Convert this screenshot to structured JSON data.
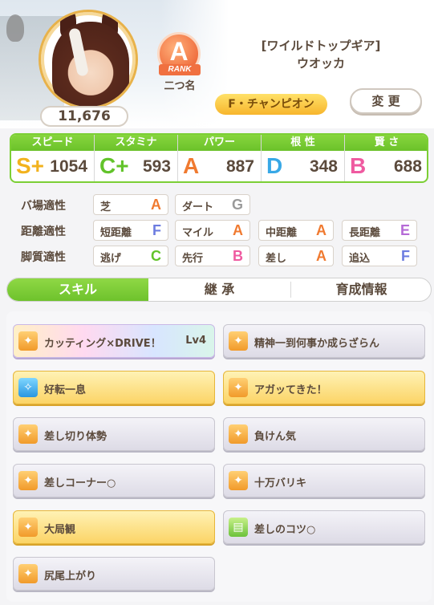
{
  "header": {
    "fans": "11,676",
    "rank": {
      "letter": "A",
      "label": "RANK"
    },
    "nickname": "二つ名",
    "title_line1": "[ワイルドトップギア]",
    "title_line2": "ウオッカ",
    "champion_title": "F・チャンピオン",
    "change_label": "変 更"
  },
  "stats": [
    {
      "label": "スピード",
      "grade": "S+",
      "value": "1054",
      "color": "#f2b21d"
    },
    {
      "label": "スタミナ",
      "grade": "C+",
      "value": "593",
      "color": "#62c32a"
    },
    {
      "label": "パワー",
      "grade": "A",
      "value": "887",
      "color": "#f07a30"
    },
    {
      "label": "根 性",
      "grade": "D",
      "value": "348",
      "color": "#38a8e6"
    },
    {
      "label": "賢 さ",
      "grade": "B",
      "value": "688",
      "color": "#ef5aa0"
    }
  ],
  "aptitude": {
    "track": {
      "label": "バ場適性",
      "items": [
        {
          "name": "芝",
          "grade": "A",
          "color": "#f07a30"
        },
        {
          "name": "ダート",
          "grade": "G",
          "color": "#9a9a9a"
        }
      ]
    },
    "distance": {
      "label": "距離適性",
      "items": [
        {
          "name": "短距離",
          "grade": "F",
          "color": "#6c7ce0"
        },
        {
          "name": "マイル",
          "grade": "A",
          "color": "#f07a30"
        },
        {
          "name": "中距離",
          "grade": "A",
          "color": "#f07a30"
        },
        {
          "name": "長距離",
          "grade": "E",
          "color": "#b56ad6"
        }
      ]
    },
    "style": {
      "label": "脚質適性",
      "items": [
        {
          "name": "逃げ",
          "grade": "C",
          "color": "#62c32a"
        },
        {
          "name": "先行",
          "grade": "B",
          "color": "#ef5aa0"
        },
        {
          "name": "差し",
          "grade": "A",
          "color": "#f07a30"
        },
        {
          "name": "追込",
          "grade": "F",
          "color": "#6c7ce0"
        }
      ]
    }
  },
  "tabs": [
    "スキル",
    "継 承",
    "育成情報"
  ],
  "skills": [
    {
      "name": "カッティング×DRIVE！",
      "level": "Lv4",
      "style": "rainbow",
      "icon": "speed-up-icon"
    },
    {
      "name": "精神一到何事か成らざらん",
      "style": "white",
      "icon": "speed-up-icon"
    },
    {
      "name": "好転一息",
      "style": "gold",
      "icon": "recovery-icon"
    },
    {
      "name": "アガッてきた！",
      "style": "gold",
      "icon": "speed-up-icon"
    },
    {
      "name": "差し切り体勢",
      "style": "white",
      "icon": "speed-up-icon"
    },
    {
      "name": "負けん気",
      "style": "white",
      "icon": "speed-up-icon"
    },
    {
      "name": "差しコーナー○",
      "style": "white",
      "icon": "speed-up-icon"
    },
    {
      "name": "十万バリキ",
      "style": "white",
      "icon": "speed-up-icon"
    },
    {
      "name": "大局観",
      "style": "gold",
      "icon": "speed-up-icon"
    },
    {
      "name": "差しのコツ○",
      "style": "white",
      "icon": "debuff-resist-icon"
    },
    {
      "name": "尻尾上がり",
      "style": "white",
      "icon": "speed-up-icon"
    }
  ]
}
